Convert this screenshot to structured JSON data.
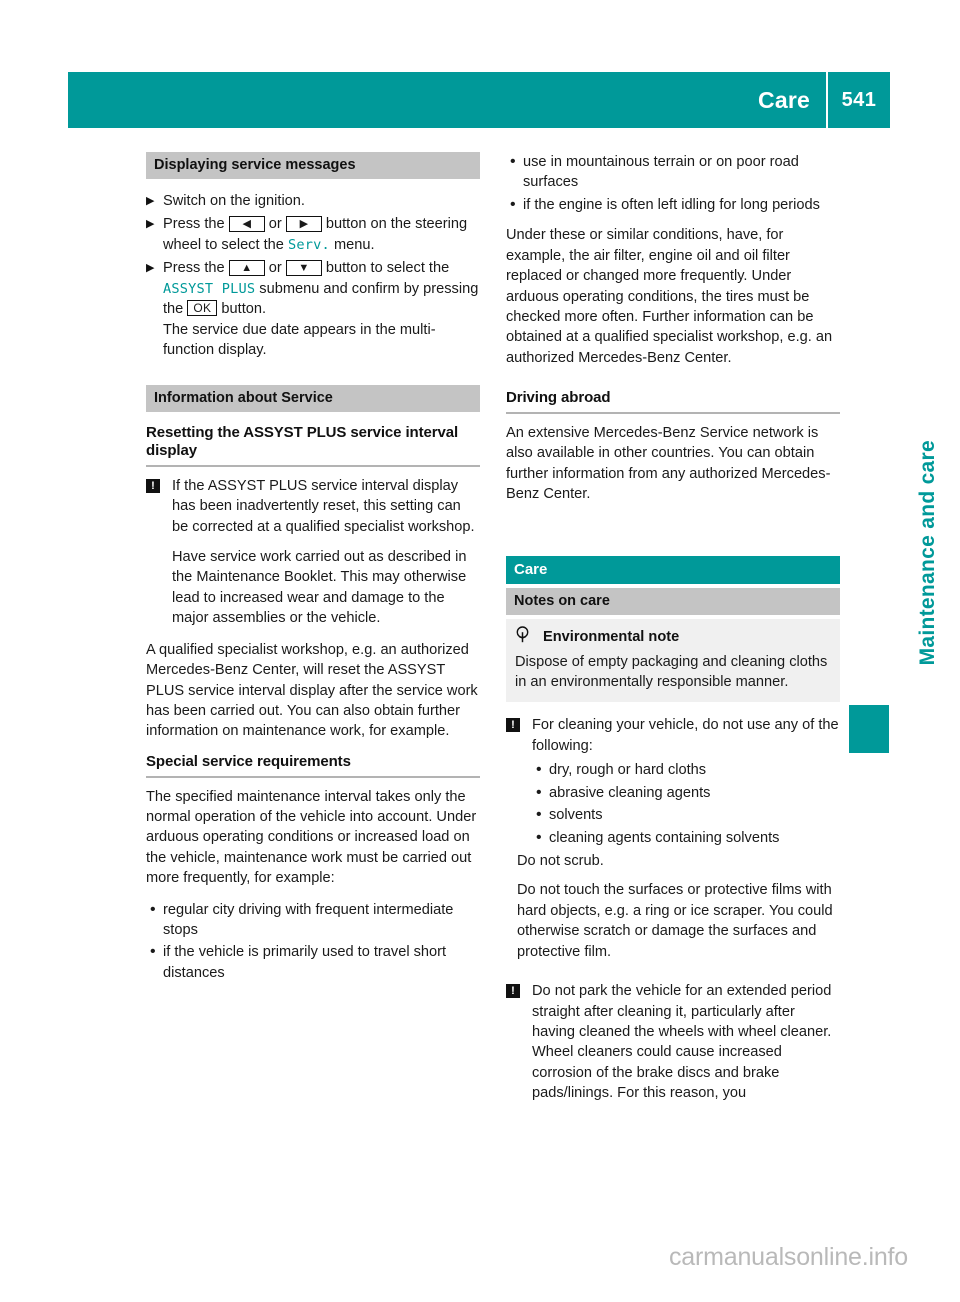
{
  "header": {
    "chapter_title": "Care",
    "page_number": "541",
    "bar_color": "#009999"
  },
  "side_tab": {
    "label": "Maintenance and care",
    "color": "#009999",
    "thumb_color": "#009999"
  },
  "watermark": {
    "text": "carmanualsonline.info"
  },
  "icons": {
    "step_marker": "▶",
    "bullet": "•",
    "warning": "!",
    "arrow_left": "◀",
    "arrow_right": "▶",
    "arrow_up": "▲",
    "arrow_down": "▼",
    "ok_key": "OK"
  },
  "left_column": {
    "section_1": {
      "band_title": "Displaying service messages",
      "steps": [
        {
          "text": "Switch on the ignition."
        },
        {
          "pre": "Press the",
          "key_a": "◀",
          "mid": "or",
          "key_b": "▶",
          "post": "button on the steer­ing wheel to select the",
          "menu": "Serv.",
          "tail": "menu."
        },
        {
          "pre": "Press the",
          "key_a": "▲",
          "mid": "or",
          "key_b": "▼",
          "post": "button to select the",
          "menu": "ASSYST PLUS",
          "tail": "submenu and confirm by pressing the",
          "key_c": "OK",
          "tail2": "button.",
          "result": "The service due date appears in the multi­function display."
        }
      ]
    },
    "section_2": {
      "band_title": "Information about Service",
      "subheading": "Resetting the ASSYST PLUS service interval display",
      "note_paragraphs": [
        "If the ASSYST PLUS service interval dis­play has been inadvertently reset, this set­ting can be corrected at a qualified special­ist workshop.",
        "Have service work carried out as described in the Maintenance Booklet. This may oth­erwise lead to increased wear and damage to the major assemblies or the vehicle."
      ],
      "paragraph": "A qualified specialist workshop, e.g. an authorized Mercedes-Benz Center, will reset the ASSYST PLUS service interval display after the service work has been carried out. You can also obtain further information on maintenance work, for example.",
      "subheading_2": "Special service requirements",
      "paragraph_2": "The specified maintenance interval takes only the normal operation of the vehicle into account. Under arduous operating conditions or increased load on the vehicle, mainte­nance work must be carried out more fre­quently, for example:",
      "bullets": [
        "regular city driving with frequent intermedi­ate stops",
        "if the vehicle is primarily used to travel short distances"
      ]
    }
  },
  "right_column": {
    "bullets_top": [
      "use in mountainous terrain or on poor road surfaces",
      "if the engine is often left idling for long peri­ods"
    ],
    "paragraph_1": "Under these or similar conditions, have, for example, the air filter, engine oil and oil filter replaced or changed more frequently. Under arduous operating conditions, the tires must be checked more often. Further information can be obtained at a qualified specialist work­shop, e.g. an authorized Mercedes-Benz Cen­ter.",
    "subheading": "Driving abroad",
    "paragraph_2": "An extensive Mercedes-Benz Service network is also available in other countries. You can obtain further information from any author­ized Mercedes-Benz Center.",
    "chapter_band": "Care",
    "section_band": "Notes on care",
    "env_note": {
      "heading": "Environmental note",
      "body": "Dispose of empty packaging and cleaning cloths in an environmentally responsible man­ner."
    },
    "warning_1": {
      "lead": "For cleaning your vehicle, do not use any of the following:",
      "bullets": [
        "dry, rough or hard cloths",
        "abrasive cleaning agents",
        "solvents",
        "cleaning agents containing solvents"
      ],
      "after": [
        "Do not scrub.",
        "Do not touch the surfaces or protective films with hard objects, e.g. a ring or ice scraper. You could otherwise scratch or damage the surfaces and protective film."
      ]
    },
    "warning_2": {
      "text": "Do not park the vehicle for an extended period straight after cleaning it, particularly after having cleaned the wheels with wheel cleaner. Wheel cleaners could cause increased corrosion of the brake discs and brake pads/linings. For this reason, you"
    }
  }
}
